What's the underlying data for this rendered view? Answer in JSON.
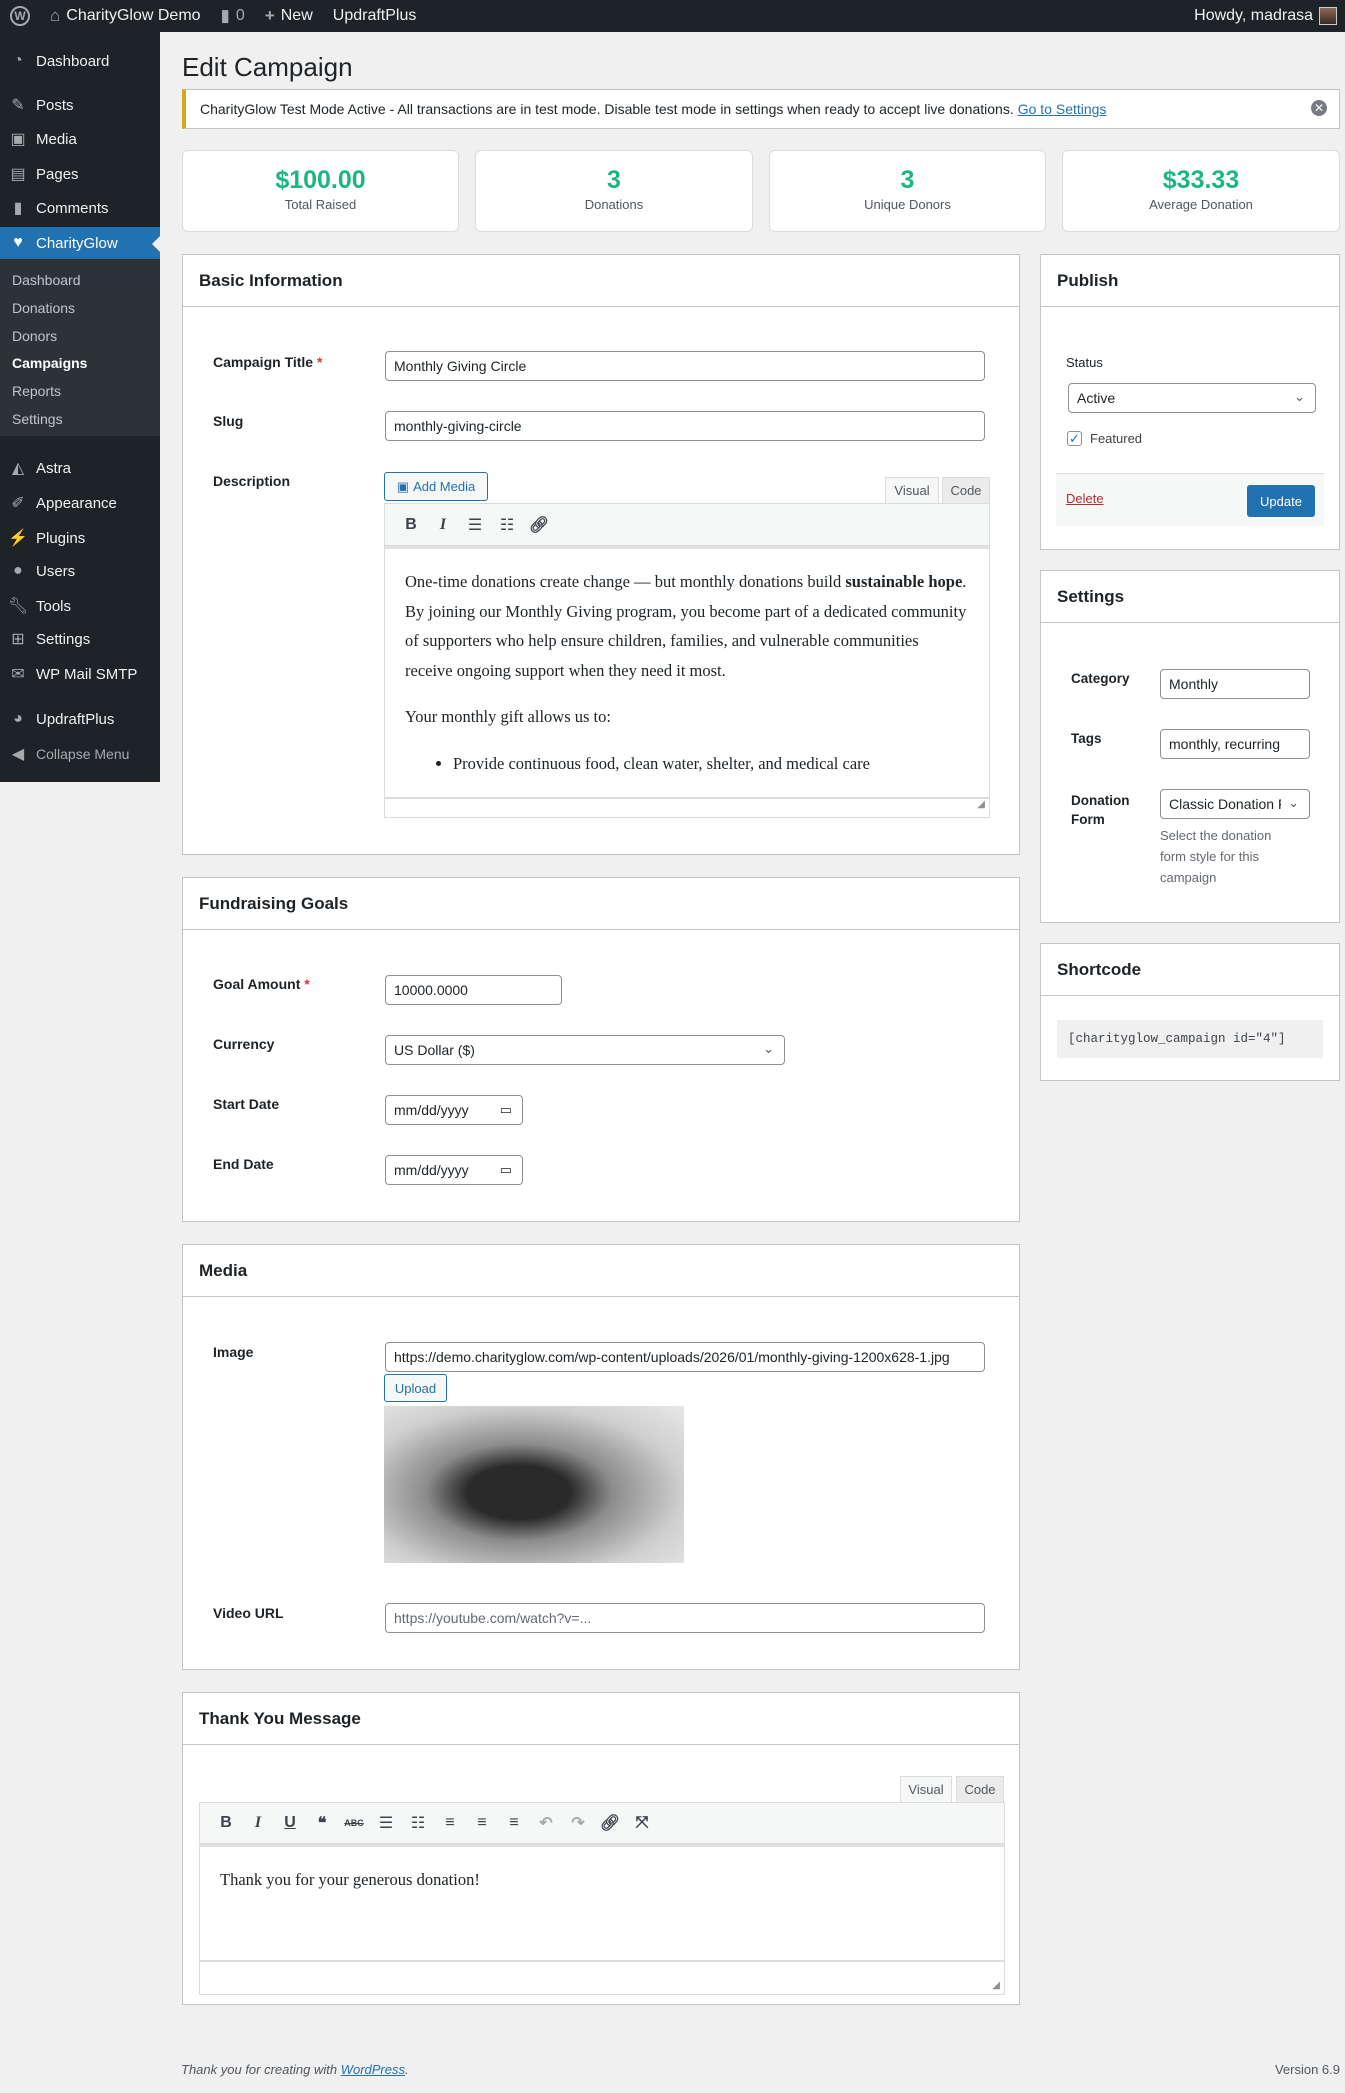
{
  "topbar": {
    "site": "CharityGlow Demo",
    "comments": "0",
    "new": "New",
    "updraft": "UpdraftPlus",
    "howdy": "Howdy, madrasa"
  },
  "sidebar": {
    "items": [
      {
        "label": "Dashboard",
        "icon": "dashboard-icon"
      },
      {
        "label": "Posts",
        "icon": "pin-icon"
      },
      {
        "label": "Media",
        "icon": "media-icon"
      },
      {
        "label": "Pages",
        "icon": "pages-icon"
      },
      {
        "label": "Comments",
        "icon": "comment-icon"
      },
      {
        "label": "CharityGlow",
        "icon": "heart-icon"
      },
      {
        "label": "Astra",
        "icon": "astra-icon"
      },
      {
        "label": "Appearance",
        "icon": "brush-icon"
      },
      {
        "label": "Plugins",
        "icon": "plugin-icon"
      },
      {
        "label": "Users",
        "icon": "user-icon"
      },
      {
        "label": "Tools",
        "icon": "wrench-icon"
      },
      {
        "label": "Settings",
        "icon": "settings-icon"
      },
      {
        "label": "WP Mail SMTP",
        "icon": "mail-icon"
      },
      {
        "label": "UpdraftPlus",
        "icon": "updraft-icon"
      },
      {
        "label": "Collapse Menu",
        "icon": "collapse-icon"
      }
    ],
    "submenu": [
      "Dashboard",
      "Donations",
      "Donors",
      "Campaigns",
      "Reports",
      "Settings"
    ]
  },
  "page_title": "Edit Campaign",
  "notice": {
    "strong": "CharityGlow Test Mode Active",
    "text": " - All transactions are in test mode. Disable test mode in settings when ready to accept live donations.",
    "link": "Go to Settings"
  },
  "stats": [
    {
      "value": "$100.00",
      "label": "Total Raised"
    },
    {
      "value": "3",
      "label": "Donations"
    },
    {
      "value": "3",
      "label": "Unique Donors"
    },
    {
      "value": "$33.33",
      "label": "Average Donation"
    }
  ],
  "basic": {
    "heading": "Basic Information",
    "title_label": "Campaign Title",
    "title_value": "Monthly Giving Circle",
    "slug_label": "Slug",
    "slug_value": "monthly-giving-circle",
    "desc_label": "Description",
    "add_media": "Add Media",
    "tab_visual": "Visual",
    "tab_code": "Code",
    "p1a": "One-time donations create change — but monthly donations build ",
    "p1b": "sustainable hope",
    "p1c": ". By joining our Monthly Giving program, you become part of a dedicated community of supporters who help ensure children, families, and vulnerable communities receive ongoing support when they need it most.",
    "p2": "Your monthly gift allows us to:",
    "li1": "Provide continuous food, clean water, shelter, and medical care"
  },
  "goals": {
    "heading": "Fundraising Goals",
    "goal_label": "Goal Amount",
    "goal_value": "10000.0000",
    "currency_label": "Currency",
    "currency_value": "US Dollar ($)",
    "start_label": "Start Date",
    "end_label": "End Date",
    "date_placeholder": "mm/dd/yyyy"
  },
  "media": {
    "heading": "Media",
    "image_label": "Image",
    "image_value": "https://demo.charityglow.com/wp-content/uploads/2026/01/monthly-giving-1200x628-1.jpg",
    "upload": "Upload",
    "video_label": "Video URL",
    "video_placeholder": "https://youtube.com/watch?v=..."
  },
  "thanks": {
    "heading": "Thank You Message",
    "tab_visual": "Visual",
    "tab_code": "Code",
    "content": "Thank you for your generous donation!"
  },
  "publish": {
    "heading": "Publish",
    "status_label": "Status",
    "status_value": "Active",
    "featured": "Featured",
    "featured_checked": true,
    "delete": "Delete",
    "update": "Update"
  },
  "settings": {
    "heading": "Settings",
    "category_label": "Category",
    "category_value": "Monthly",
    "tags_label": "Tags",
    "tags_value": "monthly, recurring",
    "form_label": "Donation Form",
    "form_value": "Classic Donation Form",
    "form_help": "Select the donation form style for this campaign"
  },
  "shortcode": {
    "heading": "Shortcode",
    "code": "[charityglow_campaign id=\"4\"]"
  },
  "footer": {
    "thanks": "Thank you for creating with ",
    "link": "WordPress",
    "version": "Version 6.9"
  },
  "colors": {
    "accent": "#2271b1",
    "stat": "#1cb67e",
    "notice": "#dba617",
    "sidebar": "#1d2327"
  }
}
